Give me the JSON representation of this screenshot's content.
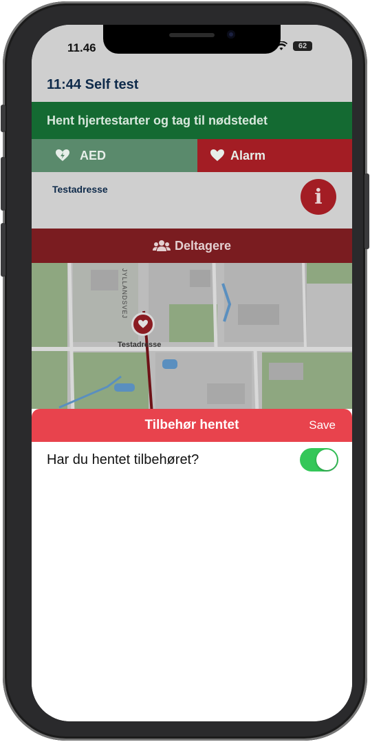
{
  "status_bar": {
    "time": "11.46",
    "battery": "62"
  },
  "header": {
    "title": "11:44 Self test"
  },
  "banner": {
    "text": "Hent hjertestarter og tag til nødstedet"
  },
  "tabs": [
    {
      "label": "AED",
      "icon": "aed-heart-icon"
    },
    {
      "label": "Alarm",
      "icon": "heart-icon"
    }
  ],
  "address": {
    "label": "Testadresse",
    "info_icon": "info-icon"
  },
  "participants": {
    "label": "Deltagere",
    "icon": "users-icon"
  },
  "map": {
    "street_label": "JYLLANDSVEJ",
    "pin_label": "Testadresse"
  },
  "sheet": {
    "title": "Tilbehør hentet",
    "save_label": "Save",
    "question": "Har du hentet tilbehøret?",
    "toggle_on": true
  },
  "colors": {
    "banner_green": "#146a32",
    "alarm_red": "#a31d24",
    "sheet_header": "#e8434d",
    "toggle_on": "#34c759"
  }
}
